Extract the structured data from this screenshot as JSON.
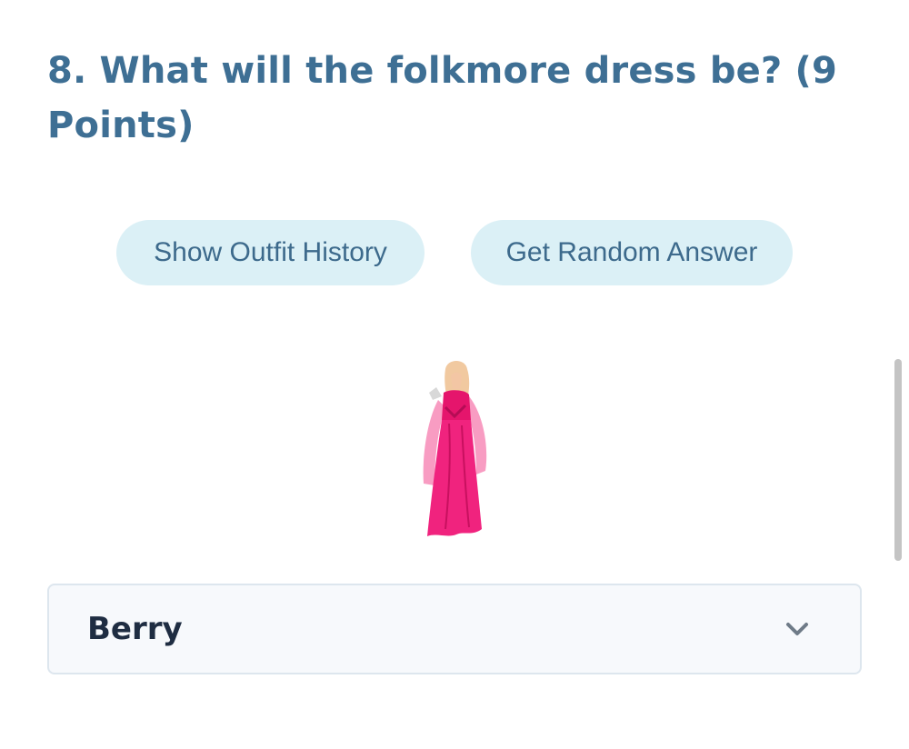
{
  "question": {
    "title": "8. What will the folkmore dress be? (9 Points)"
  },
  "buttons": {
    "outfit_history": "Show Outfit History",
    "random_answer": "Get Random Answer"
  },
  "answer_select": {
    "selected_value": "Berry",
    "icon": "chevron-down-icon"
  },
  "colors": {
    "title": "#3e6f94",
    "button_bg": "#dbf0f6",
    "button_text": "#3d6a8c",
    "dress": "#f0237e",
    "select_bg": "#f7f9fc"
  }
}
